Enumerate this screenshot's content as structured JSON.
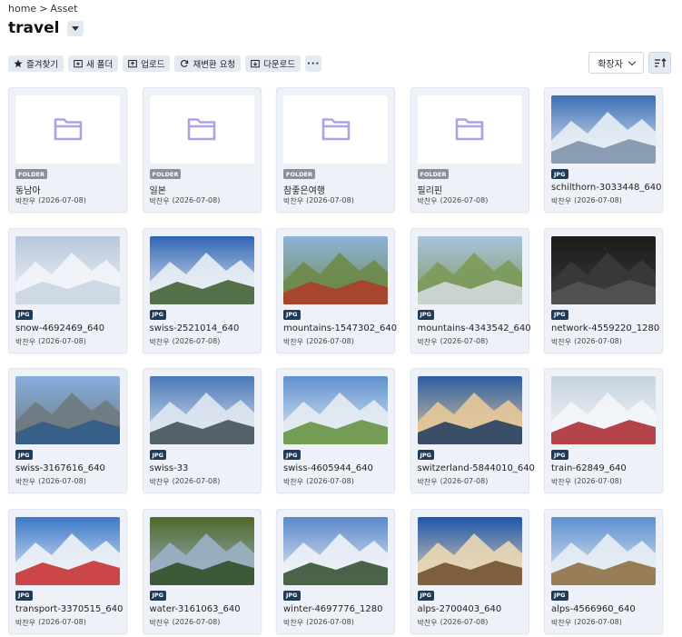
{
  "breadcrumb": [
    "home",
    ">",
    "Asset"
  ],
  "title": "travel",
  "toolbar": [
    {
      "label": "즐겨찾기",
      "icon": "star-icon"
    },
    {
      "label": "새 폴더",
      "icon": "new-folder-icon"
    },
    {
      "label": "업로드",
      "icon": "upload-icon"
    },
    {
      "label": "재변환 요청",
      "icon": "refresh-icon"
    },
    {
      "label": "다운로드",
      "icon": "download-icon"
    }
  ],
  "more_label": "···",
  "sort": {
    "label": "확장자"
  },
  "items": [
    {
      "name": "동남아",
      "type": "FOLDER",
      "author": "박찬우",
      "date": "(2026-07-08)"
    },
    {
      "name": "일본",
      "type": "FOLDER",
      "author": "박찬우",
      "date": "(2026-07-08)"
    },
    {
      "name": "참좋은여행",
      "type": "FOLDER",
      "author": "박찬우",
      "date": "(2026-07-08)"
    },
    {
      "name": "필리핀",
      "type": "FOLDER",
      "author": "박찬우",
      "date": "(2026-07-08)"
    },
    {
      "name": "schilthorn-3033448_640",
      "type": "JPG",
      "author": "박찬우",
      "date": "(2026-07-08)",
      "palette": [
        "#3b6fb6",
        "#e8eef5",
        "#7a8ea8"
      ]
    },
    {
      "name": "snow-4692469_640",
      "type": "JPG",
      "author": "박찬우",
      "date": "(2026-07-08)",
      "palette": [
        "#b7c7da",
        "#f2f5f9",
        "#c9d4e2"
      ]
    },
    {
      "name": "swiss-2521014_640",
      "type": "JPG",
      "author": "박찬우",
      "date": "(2026-07-08)",
      "palette": [
        "#2f66b3",
        "#e9eef4",
        "#3a5a2a"
      ]
    },
    {
      "name": "mountains-1547302_640",
      "type": "JPG",
      "author": "박찬우",
      "date": "(2026-07-08)",
      "palette": [
        "#8fb3d9",
        "#6d8a4a",
        "#b23a2a"
      ]
    },
    {
      "name": "mountains-4343542_640",
      "type": "JPG",
      "author": "박찬우",
      "date": "(2026-07-08)",
      "palette": [
        "#a9c3dd",
        "#7d9a5a",
        "#d7dde3"
      ]
    },
    {
      "name": "network-4559220_1280",
      "type": "JPG",
      "author": "박찬우",
      "date": "(2026-07-08)",
      "palette": [
        "#1b1b1b",
        "#3a3a3a",
        "#555555"
      ]
    },
    {
      "name": "swiss-3167616_640",
      "type": "JPG",
      "author": "박찬우",
      "date": "(2026-07-08)",
      "palette": [
        "#86aede",
        "#6f7a80",
        "#2f5a8a"
      ]
    },
    {
      "name": "swiss-33",
      "type": "JPG",
      "author": "박찬우",
      "date": "(2026-07-08)",
      "palette": [
        "#4a78b8",
        "#dfe7f0",
        "#3d4a52"
      ]
    },
    {
      "name": "swiss-4605944_640",
      "type": "JPG",
      "author": "박찬우",
      "date": "(2026-07-08)",
      "palette": [
        "#5f92cf",
        "#e6ecf2",
        "#5f8f3a"
      ]
    },
    {
      "name": "switzerland-5844010_640",
      "type": "JPG",
      "author": "박찬우",
      "date": "(2026-07-08)",
      "palette": [
        "#2c5fa3",
        "#e6c89a",
        "#1c3a5e"
      ]
    },
    {
      "name": "train-62849_640",
      "type": "JPG",
      "author": "박찬우",
      "date": "(2026-07-08)",
      "palette": [
        "#c7d3e0",
        "#f4f6f8",
        "#a8242a"
      ]
    },
    {
      "name": "transport-3370515_640",
      "type": "JPG",
      "author": "박찬우",
      "date": "(2026-07-08)",
      "palette": [
        "#3a78c8",
        "#eef2f6",
        "#c62828"
      ]
    },
    {
      "name": "water-3161063_640",
      "type": "JPG",
      "author": "박찬우",
      "date": "(2026-07-08)",
      "palette": [
        "#4f6a2a",
        "#9bb1c5",
        "#2e4a1e"
      ]
    },
    {
      "name": "winter-4697776_1280",
      "type": "JPG",
      "author": "박찬우",
      "date": "(2026-07-08)",
      "palette": [
        "#5a88c9",
        "#eef2f7",
        "#2d4a2a"
      ]
    },
    {
      "name": "alps-2700403_640",
      "type": "JPG",
      "author": "박찬우",
      "date": "(2026-07-08)",
      "palette": [
        "#1f56a8",
        "#e9d7b6",
        "#6b4a2a"
      ]
    },
    {
      "name": "alps-4566960_640",
      "type": "JPG",
      "author": "박찬우",
      "date": "(2026-07-08)",
      "palette": [
        "#5b8fd0",
        "#e8eef4",
        "#8a6a3a"
      ]
    }
  ]
}
